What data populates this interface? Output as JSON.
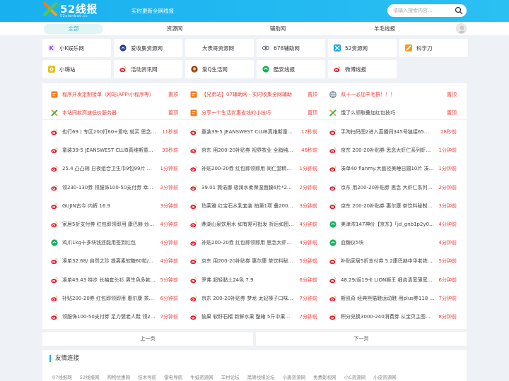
{
  "header": {
    "logo_text": "52线报",
    "logo_sub": "52xianbao.cc",
    "slogan": "实时更新全网线报",
    "search_placeholder": "请输入搜索内容..."
  },
  "nav": {
    "items": [
      "全部",
      "资源网",
      "辅助网",
      "羊毛线报"
    ]
  },
  "quick_links": [
    {
      "label": "小K娱乐网",
      "icon": "k-icon",
      "color": "#8a4bd8"
    },
    {
      "label": "爱收集资源网",
      "icon": "collect-icon",
      "color": "#2a3f8f"
    },
    {
      "label": "大表哥资源网",
      "icon": "",
      "color": ""
    },
    {
      "label": "678辅助网",
      "icon": "eye-icon",
      "color": "#3b4a6b"
    },
    {
      "label": "52资源网",
      "icon": "52-icon",
      "color": "#19a7e8"
    },
    {
      "label": "科学刀",
      "icon": "knife-icon",
      "color": "#f0a020"
    },
    {
      "label": "小嗨站",
      "icon": "hi-icon",
      "color": "#e6c21c"
    },
    {
      "label": "活动资讯网",
      "icon": "weibo-icon",
      "color": "#e6162d"
    },
    {
      "label": "爱Q生活网",
      "icon": "q-icon",
      "color": "#8b3a1a"
    },
    {
      "label": "酷安线报",
      "icon": "coolapk-icon",
      "color": "#11b15b"
    },
    {
      "label": "微博线报",
      "icon": "weibo-icon",
      "color": "#e6162d"
    }
  ],
  "top_rows": [
    [
      {
        "icon": "tag-icon",
        "icon_color": "#f07c1e",
        "title": "程序开发定制接单（网站\\APP\\小程序等）",
        "red": true,
        "time": "置顶"
      },
      {
        "icon": "tag-icon",
        "icon_color": "#f07c1e",
        "title": "【兄弟站】07辅助网 - 实时收集全网辅助",
        "red": true,
        "time": "置顶"
      },
      {
        "icon": "globe-icon",
        "icon_color": "#5a6e7e",
        "title": "双十一必加羊毛群！！！",
        "red": true,
        "time": "置顶"
      }
    ],
    [
      {
        "icon": "x-icon",
        "icon_color": "#35b25a",
        "title": "本站同款高速低价服务器",
        "red": true,
        "time": "置顶"
      },
      {
        "icon": "tag-icon",
        "icon_color": "#f07c1e",
        "title": "分享一个生活优惠省钱的小技巧",
        "red": true,
        "time": "置顶"
      },
      {
        "icon": "x-icon",
        "icon_color": "#35b25a",
        "title": "饿了么领取叠加红包技巧",
        "red": false,
        "time": "置顶"
      }
    ]
  ],
  "rows": [
    [
      {
        "icon": "weibo-icon",
        "title": "也行69丨专区200打60+爱吃 就买 思念…",
        "time": "11秒前"
      },
      {
        "icon": "weibo-icon",
        "title": "童装39-5 JEANSWEST CLUB真维斯童…",
        "time": "17秒前"
      },
      {
        "icon": "weibo-icon",
        "title": "手淘扫码图2进入直播间345号链接65…",
        "time": "28秒前"
      }
    ],
    [
      {
        "icon": "weibo-icon",
        "title": "童装39-5 JEANSWEST CLUB真维斯童…",
        "time": "33秒前"
      },
      {
        "icon": "weibo-icon",
        "title": "京东 用200-20补贴券 视界牧业 全脂纯…",
        "time": "46秒前"
      },
      {
        "icon": "weibo-icon",
        "title": "京东 200-20补贴券 思念大虾仁系列虾…",
        "time": "1分钟前"
      }
    ],
    [
      {
        "icon": "weibo-icon",
        "title": "25.4 凸凸棉 日夜组合卫生巾9包99片 需…",
        "time": "1分钟前"
      },
      {
        "icon": "weibo-icon",
        "title": "补贴200-20券 红包即领即用 同仁堂精…",
        "time": "1分钟前"
      },
      {
        "icon": "weibo-icon",
        "title": "凑单40 flanmy.大庭径美睡日圆10片 凑…",
        "time": "1分钟前"
      }
    ],
    [
      {
        "icon": "weibo-icon",
        "title": "领230-130券 领服饰100-50支付券 幸福…",
        "time": "2分钟前"
      },
      {
        "icon": "weibo-icon",
        "title": "39.01 薇诺娜 极润水柔保湿面膜6片*2盒…",
        "time": "2分钟前"
      },
      {
        "icon": "weibo-icon",
        "title": "京东 用200-20补贴券 思念 大虾仁系列…",
        "time": "2分钟前"
      }
    ],
    [
      {
        "icon": "weibo-icon",
        "title": "GUJIN古今 内裤 16.9",
        "time": "3分钟前"
      },
      {
        "icon": "weibo-icon",
        "title": "珀莱雅 红宝石水乳套装 拍第1项 叠200…",
        "time": "3分钟前"
      },
      {
        "icon": "weibo-icon",
        "title": "京东 200-20补贴券 惠尔康 茶饮料秘制…",
        "time": "3分钟前"
      }
    ],
    [
      {
        "icon": "weibo-icon",
        "title": "家居5折支付券 红包即领即用 康巴赫 炒…",
        "time": "4分钟前"
      },
      {
        "icon": "weibo-icon",
        "title": "鼎湖山泉饮用水 如有需可批发 折后如图…",
        "time": "4分钟前"
      },
      {
        "icon": "coolapk-icon",
        "title": "美津浓147神价【京东】「jd_gnb1p2y0…",
        "time": "4分钟前"
      }
    ],
    [
      {
        "icon": "coolapk-icon",
        "title": "鸡爪1kg十多块钱还能用签到红包",
        "time": "4分钟前"
      },
      {
        "icon": "weibo-icon",
        "title": "补贴200-20券 红包即领即用 思念大虾…",
        "time": "4分钟前"
      },
      {
        "icon": "coolapk-icon",
        "title": "血糖仪5块",
        "time": "4分钟前"
      }
    ],
    [
      {
        "icon": "weibo-icon",
        "title": "凑单32.68/ 自然之珍 提离素软糖60粒/…",
        "time": "4分钟前"
      },
      {
        "icon": "weibo-icon",
        "title": "京东 用200-20补贴券 惠尔康 茶饮料秘…",
        "time": "5分钟前"
      },
      {
        "icon": "weibo-icon",
        "title": "补贴家居5折支付券 5.2康巴赫中华老铁…",
        "time": "5分钟前"
      }
    ],
    [
      {
        "icon": "weibo-icon",
        "title": "凑单49.43 特步 长袖套头衫 男生色多款…",
        "time": "5分钟前"
      },
      {
        "icon": "weibo-icon",
        "title": "罗弗 超轻黏土24色 7.9",
        "time": "6分钟前"
      },
      {
        "icon": "weibo-icon",
        "title": "48.29/返19卡 LION狮王 细齿清宽薄宽…",
        "time": "6分钟前"
      }
    ],
    [
      {
        "icon": "weibo-icon",
        "title": "补贴200-20券 红包即领即用 惠尔康 茶…",
        "time": "6分钟前"
      },
      {
        "icon": "weibo-icon",
        "title": "京东 200-20补贴券 梦龙 太妃榛子口味…",
        "time": "7分钟前"
      },
      {
        "icon": "weibo-icon",
        "title": "斯凯奇 经典熊猫鞋运动鞋 用plus券118 …",
        "time": "7分钟前"
      }
    ],
    [
      {
        "icon": "weibo-icon",
        "title": "领服饰100-50支付券 足力健老人鞋 领2…",
        "time": "7分钟前"
      },
      {
        "icon": "weibo-icon",
        "title": "愉果 软籽石榴 新鲜水果 整箱 5斤中果…",
        "time": "7分钟前"
      },
      {
        "icon": "weibo-icon",
        "title": "积分兑换3000-240消费券 从宝贝主图进…",
        "time": "8分钟前"
      }
    ]
  ],
  "pager": {
    "prev": "上一页",
    "next": "下一页"
  },
  "friends": {
    "title": "友情连接",
    "links": [
      "07线报网",
      "52线报网",
      "购物优惠网",
      "技术导航",
      "雷电导航",
      "牛蛙资源网",
      "羊村论坛",
      "黑眼线报论坛",
      "小唐资源网",
      "免费影视网",
      "小C资源网",
      "小皮资源网"
    ]
  },
  "colors": {
    "header": "#19b0f0",
    "accent": "#2fb7bd",
    "red": "#e8433d",
    "weibo": "#e6162d",
    "coolapk": "#11b15b"
  }
}
